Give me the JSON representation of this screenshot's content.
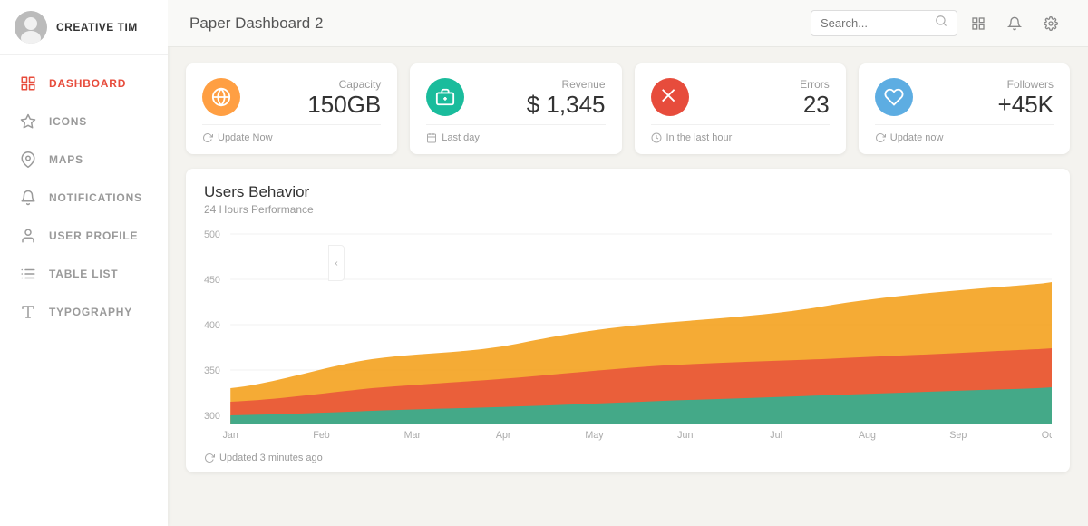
{
  "brand": {
    "name": "CREATIVE TIM"
  },
  "sidebar": {
    "items": [
      {
        "id": "dashboard",
        "label": "DASHBOARD",
        "icon": "home",
        "active": true
      },
      {
        "id": "icons",
        "label": "ICONS",
        "icon": "star",
        "active": false
      },
      {
        "id": "maps",
        "label": "MAPS",
        "icon": "map-pin",
        "active": false
      },
      {
        "id": "notifications",
        "label": "NOTIFICATIONS",
        "icon": "bell",
        "active": false
      },
      {
        "id": "user-profile",
        "label": "USER PROFILE",
        "icon": "user",
        "active": false
      },
      {
        "id": "table-list",
        "label": "TABLE LIST",
        "icon": "list",
        "active": false
      },
      {
        "id": "typography",
        "label": "TYPOGRAPHY",
        "icon": "type",
        "active": false
      }
    ]
  },
  "header": {
    "title": "Paper Dashboard 2",
    "search_placeholder": "Search...",
    "icons": [
      "grid",
      "bell",
      "settings"
    ]
  },
  "stats": [
    {
      "label": "Capacity",
      "value": "150GB",
      "footer": "Update Now",
      "icon_type": "orange",
      "icon": "globe"
    },
    {
      "label": "Revenue",
      "value": "$ 1,345",
      "footer": "Last day",
      "icon_type": "green",
      "icon": "money"
    },
    {
      "label": "Errors",
      "value": "23",
      "footer": "In the last hour",
      "icon_type": "red",
      "icon": "curve"
    },
    {
      "label": "Followers",
      "value": "+45K",
      "footer": "Update now",
      "icon_type": "blue",
      "icon": "heart"
    }
  ],
  "chart": {
    "title": "Users Behavior",
    "subtitle": "24 Hours Performance",
    "footer": "Updated 3 minutes ago",
    "x_labels": [
      "Jan",
      "Feb",
      "Mar",
      "Apr",
      "May",
      "Jun",
      "Jul",
      "Aug",
      "Sep",
      "Oct"
    ],
    "y_labels": [
      "500",
      "450",
      "400",
      "350",
      "300"
    ],
    "colors": {
      "layer1": "#f39c12",
      "layer2": "#e74c3c",
      "layer3": "#1abc9c"
    }
  },
  "colors": {
    "sidebar_active": "#e74c3c",
    "accent_orange": "#ff9800",
    "accent_green": "#1abc9c",
    "accent_red": "#e74c3c",
    "accent_blue": "#5dade2"
  }
}
